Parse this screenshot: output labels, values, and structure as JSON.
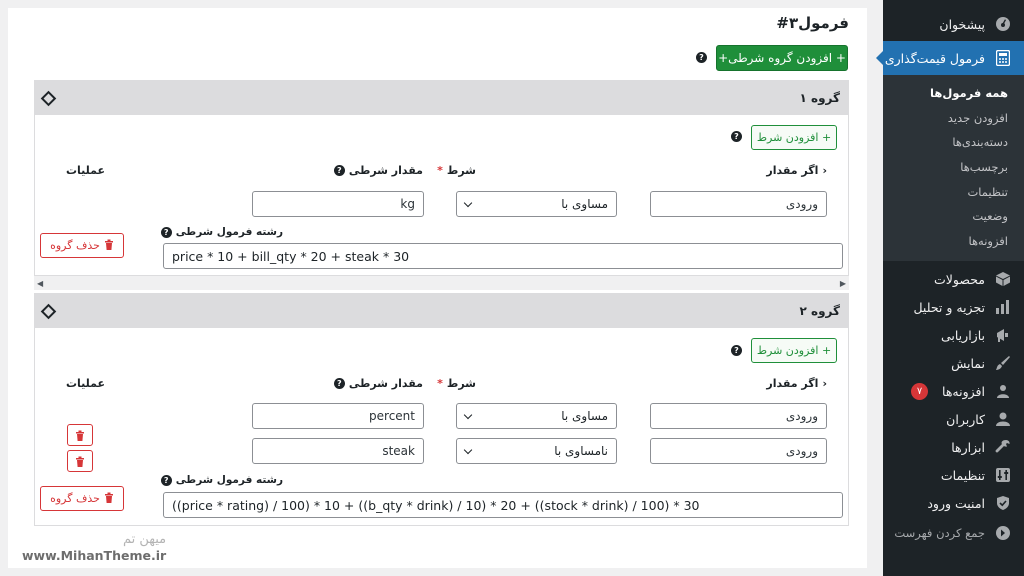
{
  "sidebar": {
    "menu_top": [
      {
        "label": "پیشخوان",
        "icon": "dashboard-icon"
      }
    ],
    "active": {
      "label": "فرمول قیمت‌گذاری",
      "icon": "calculator-icon"
    },
    "submenu": [
      {
        "label": "همه فرمول‌ها",
        "current": true
      },
      {
        "label": "افزودن جدید"
      },
      {
        "label": "دسته‌بندی‌ها"
      },
      {
        "label": "برچسب‌ها"
      },
      {
        "label": "تنظیمات"
      },
      {
        "label": "وضعیت"
      },
      {
        "label": "افزونه‌ها"
      }
    ],
    "menu_bottom": [
      {
        "label": "محصولات",
        "icon": "box-icon"
      },
      {
        "label": "تجزیه و تحلیل",
        "icon": "analytics-icon"
      },
      {
        "label": "بازاریابی",
        "icon": "megaphone-icon"
      },
      {
        "label": "نمایش",
        "icon": "brush-icon"
      },
      {
        "label": "افزونه‌ها",
        "icon": "plugin-icon",
        "badge": "۷"
      },
      {
        "label": "کاربران",
        "icon": "user-icon"
      },
      {
        "label": "ابزارها",
        "icon": "wrench-icon"
      },
      {
        "label": "تنظیمات",
        "icon": "settings-icon"
      },
      {
        "label": "امنیت ورود",
        "icon": "shield-icon"
      }
    ],
    "collapse_label": "جمع کردن فهرست"
  },
  "page": {
    "title": "فرمول۳#",
    "add_group_label": "+ افزودن گروه شرطی+"
  },
  "groups": [
    {
      "title": "گروه ۱",
      "add_condition_label": "+ افزودن شرط",
      "col_if_value": "اگر مقدار",
      "col_condition": "شرط",
      "col_condition_value": "مقدار شرطی",
      "col_operations": "عملیات",
      "rows": [
        {
          "input": "ورودی",
          "operator": "مساوی با",
          "value": "kg"
        }
      ],
      "formula_label": "رشته فرمول شرطی",
      "formula": "price * 10 + bill_qty * 20 + steak * 30",
      "delete_label": "حذف گروه"
    },
    {
      "title": "گروه ۲",
      "add_condition_label": "+ افزودن شرط",
      "col_if_value": "اگر مقدار",
      "col_condition": "شرط",
      "col_condition_value": "مقدار شرطی",
      "col_operations": "عملیات",
      "rows": [
        {
          "input": "ورودی",
          "operator": "مساوی با",
          "value": "percent"
        },
        {
          "input": "ورودی",
          "operator": "نامساوی با",
          "value": "steak"
        }
      ],
      "formula_label": "رشته فرمول شرطی",
      "formula": "((price * rating) / 100) * 10 + ((b_qty * drink) / 10) * 20 + ((stock * drink) / 100) * 30",
      "delete_label": "حذف گروه"
    }
  ],
  "watermark": {
    "fa": "میهن تم",
    "url": "www.MihanTheme.ir"
  },
  "colors": {
    "sidebar_bg": "#1d2327",
    "active_menu": "#2271b1",
    "primary_green": "#1f8f3a",
    "danger": "#d63638"
  }
}
